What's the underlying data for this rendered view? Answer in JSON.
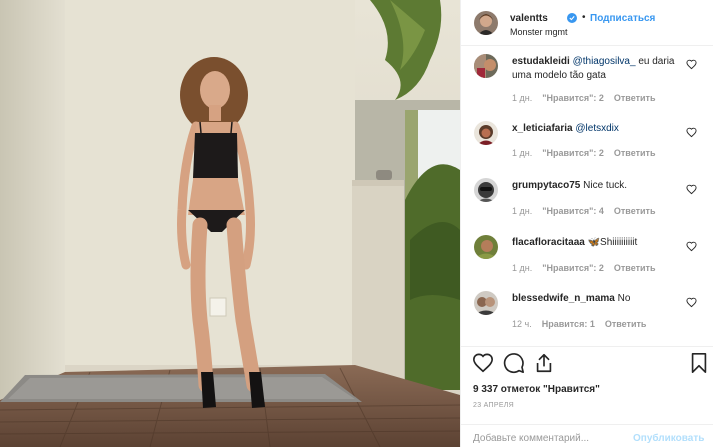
{
  "colors": {
    "accent": "#3897f0",
    "muted": "#999999",
    "text": "#262626",
    "publish_disabled": "#b2dffc"
  },
  "post": {
    "username": "valentts",
    "verified": true,
    "separator": "•",
    "follow_label": "Подписаться",
    "subtitle": "Monster mgmt"
  },
  "comments": [
    {
      "user": "estudakleidi",
      "mention": "@thiagosilva_",
      "text": " eu daria uma modelo tão gata",
      "time": "1 дн.",
      "likes": "\"Нравится\": 2",
      "reply": "Ответить"
    },
    {
      "user": "x_leticiafaria",
      "mention": "@letsxdix",
      "text": "",
      "time": "1 дн.",
      "likes": "\"Нравится\": 2",
      "reply": "Ответить"
    },
    {
      "user": "grumpytaco75",
      "mention": "",
      "text": " Nice tuck.",
      "time": "1 дн.",
      "likes": "\"Нравится\": 4",
      "reply": "Ответить"
    },
    {
      "user": "flacafloracitaaa",
      "mention": "",
      "text": " 🦋Shiiiiiiiiiit",
      "time": "1 дн.",
      "likes": "\"Нравится\": 2",
      "reply": "Ответить"
    },
    {
      "user": "blessedwife_n_mama",
      "mention": "",
      "text": " No",
      "time": "12 ч.",
      "likes": "Нравится: 1",
      "reply": "Ответить"
    }
  ],
  "icons": {
    "like": "heart-icon",
    "comment": "comment-bubble-icon",
    "share": "share-icon",
    "save": "bookmark-icon"
  },
  "stats": {
    "likes": "9 337 отметок \"Нравится\"",
    "date": "23 АПРЕЛЯ"
  },
  "add_comment": {
    "placeholder": "Добавьте комментарий...",
    "publish_label": "Опубликовать"
  }
}
